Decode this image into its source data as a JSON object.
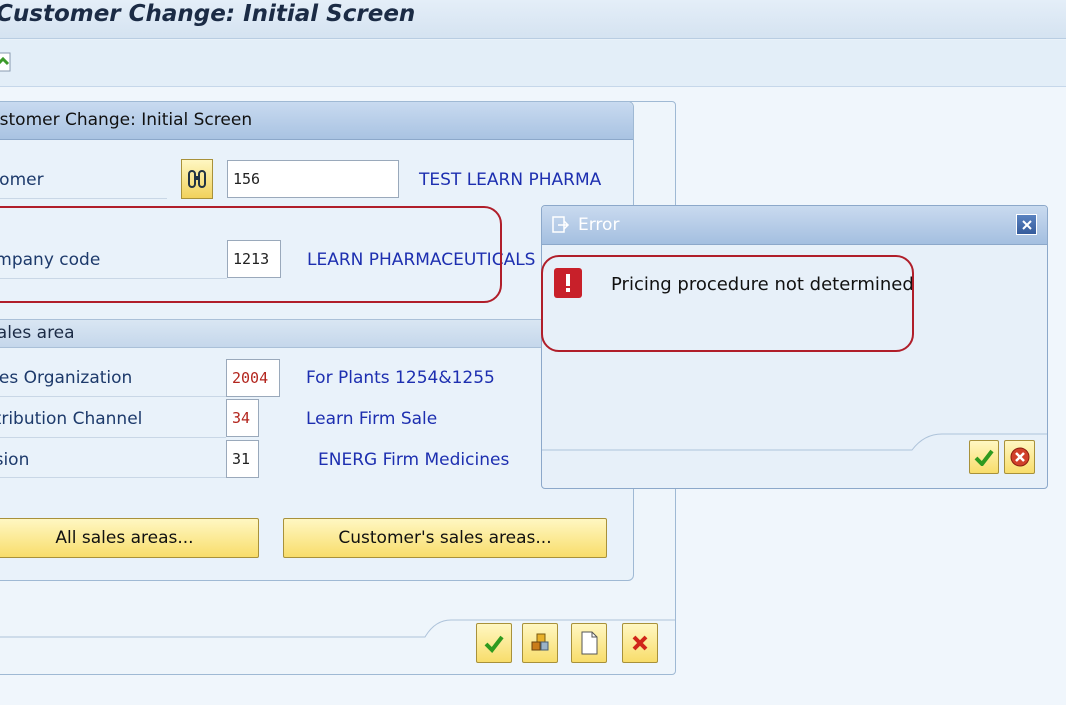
{
  "window": {
    "title": "Customer Change: Initial Screen"
  },
  "toolbar": {
    "icon": "execute-icon"
  },
  "dialog": {
    "title": "Customer Change: Initial Screen",
    "customer": {
      "label": "Customer",
      "value": "156",
      "description": "TEST LEARN PHARMA"
    },
    "company_code": {
      "label": "Company code",
      "value": "1213",
      "description": "LEARN PHARMACEUTICALS"
    },
    "sales_area": {
      "title": "Sales area",
      "sales_org": {
        "label": "Sales Organization",
        "value": "2004",
        "description": "For Plants 1254&1255"
      },
      "dist_channel": {
        "label": "Distribution Channel",
        "value": "34",
        "description": "Learn Firm Sale"
      },
      "division": {
        "label": "Division",
        "value": "31",
        "description": "ENERG Firm Medicines"
      }
    },
    "buttons": {
      "all_sales_areas": "All sales areas...",
      "customers_sales_areas": "Customer's sales areas..."
    }
  },
  "error_popup": {
    "title": "Error",
    "message": "Pricing procedure not determined"
  },
  "colors": {
    "required_value": "#b3261e",
    "description_text": "#1d2fb0",
    "highlight": "#b01e2a"
  }
}
